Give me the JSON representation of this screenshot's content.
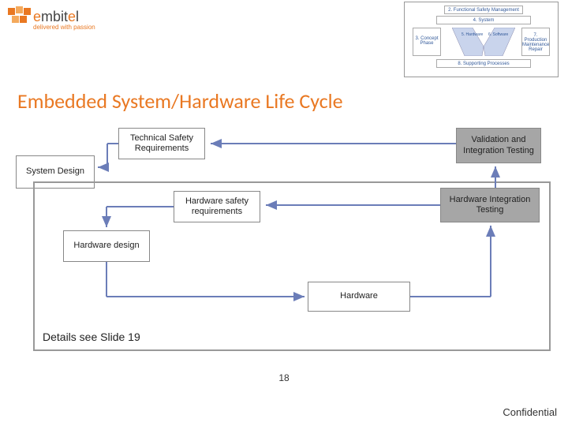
{
  "logo": {
    "name": "embitel",
    "tagline": "delivered with passion"
  },
  "top_mini": {
    "row1": "2. Functional Safety Management",
    "row2": "4. System",
    "left_box": "3. Concept Phase",
    "right_box": "7. Production Maintenance Repair",
    "v_left": "5. Hardware",
    "v_right": "6. Software",
    "row3": "8. Supporting Processes"
  },
  "title": "Embedded System/Hardware Life Cycle",
  "boxes": {
    "tech_safety_req": "Technical Safety\nRequirements",
    "validation": "Validation and\nIntegration Testing",
    "system_design": "System Design",
    "hw_safety_req": "Hardware safety\nrequirements",
    "hw_int_test": "Hardware Integration\nTesting",
    "hw_design": "Hardware design",
    "hardware": "Hardware"
  },
  "details_label": "Details see Slide 19",
  "page_number": "18",
  "footer": "Confidential",
  "colors": {
    "accent": "#e97822",
    "box_grey": "#a6a6a6",
    "arrow": "#6b7db8"
  }
}
